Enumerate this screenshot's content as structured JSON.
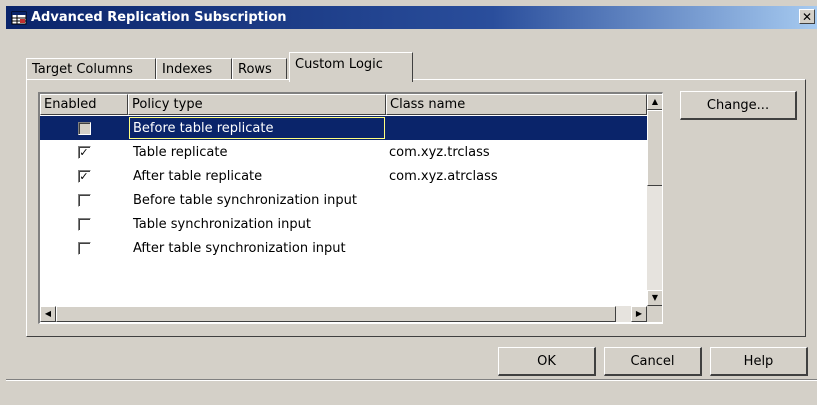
{
  "window": {
    "title": "Advanced Replication Subscription",
    "close_glyph": "✕"
  },
  "tabs": [
    {
      "label": "Target Columns"
    },
    {
      "label": "Indexes"
    },
    {
      "label": "Rows"
    },
    {
      "label": "Custom Logic",
      "active": true
    }
  ],
  "grid": {
    "columns": [
      "Enabled",
      "Policy type",
      "Class name"
    ],
    "rows": [
      {
        "enabled": false,
        "policy": "Before table replicate",
        "class_name": "",
        "selected": true
      },
      {
        "enabled": true,
        "policy": "Table replicate",
        "class_name": "com.xyz.trclass"
      },
      {
        "enabled": true,
        "policy": "After table replicate",
        "class_name": "com.xyz.atrclass"
      },
      {
        "enabled": false,
        "policy": "Before table synchronization input",
        "class_name": ""
      },
      {
        "enabled": false,
        "policy": "Table synchronization input",
        "class_name": ""
      },
      {
        "enabled": false,
        "policy": "After table synchronization input",
        "class_name": ""
      }
    ],
    "check_glyph": "✓"
  },
  "buttons": {
    "change": "Change...",
    "ok": "OK",
    "cancel": "Cancel",
    "help": "Help"
  },
  "colors": {
    "selection": "#0a246a",
    "title_bar": "#0a246a",
    "face": "#d4d0c8"
  },
  "icons": {
    "app": "table-icon",
    "close": "close-icon"
  }
}
